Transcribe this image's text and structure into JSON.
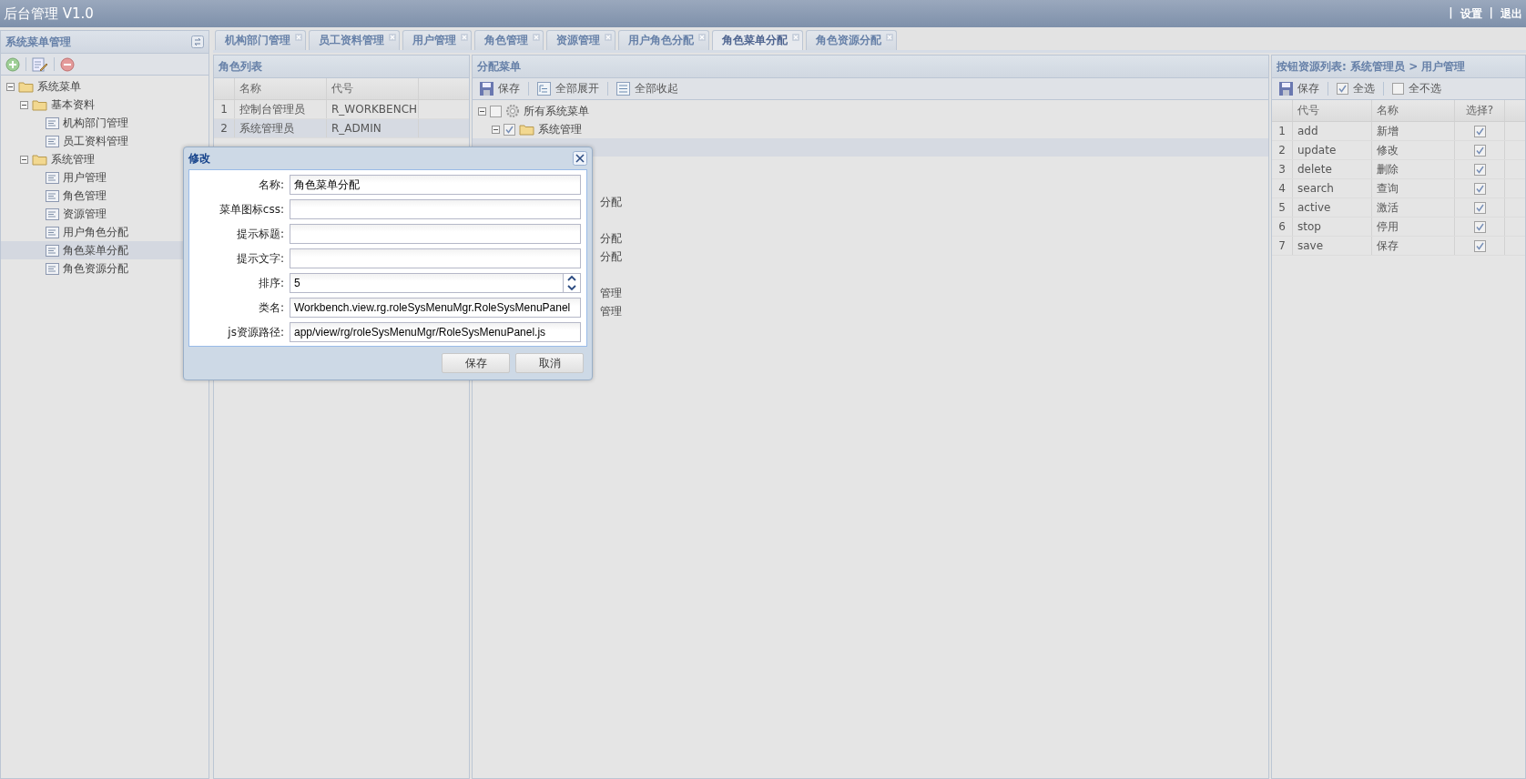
{
  "header": {
    "title": "后台管理 V1.0",
    "separator": "|",
    "links": [
      "设置",
      "退出"
    ]
  },
  "left_panel": {
    "title": "系统菜单管理",
    "tree": [
      {
        "label": "系统菜单",
        "kind": "folder",
        "expanded": true,
        "selected": false,
        "children": [
          {
            "label": "基本资料",
            "kind": "folder",
            "expanded": true,
            "selected": false,
            "children": [
              {
                "label": "机构部门管理",
                "kind": "leaf",
                "selected": false
              },
              {
                "label": "员工资料管理",
                "kind": "leaf",
                "selected": false
              }
            ]
          },
          {
            "label": "系统管理",
            "kind": "folder",
            "expanded": true,
            "selected": false,
            "children": [
              {
                "label": "用户管理",
                "kind": "leaf",
                "selected": false
              },
              {
                "label": "角色管理",
                "kind": "leaf",
                "selected": false
              },
              {
                "label": "资源管理",
                "kind": "leaf",
                "selected": false
              },
              {
                "label": "用户角色分配",
                "kind": "leaf",
                "selected": false
              },
              {
                "label": "角色菜单分配",
                "kind": "leaf",
                "selected": true
              },
              {
                "label": "角色资源分配",
                "kind": "leaf",
                "selected": false
              }
            ]
          }
        ]
      }
    ]
  },
  "tabs": [
    {
      "label": "机构部门管理",
      "selected": false
    },
    {
      "label": "员工资料管理",
      "selected": false
    },
    {
      "label": "用户管理",
      "selected": false
    },
    {
      "label": "角色管理",
      "selected": false
    },
    {
      "label": "资源管理",
      "selected": false
    },
    {
      "label": "用户角色分配",
      "selected": false
    },
    {
      "label": "角色菜单分配",
      "selected": true
    },
    {
      "label": "角色资源分配",
      "selected": false
    }
  ],
  "role_list": {
    "title": "角色列表",
    "columns": [
      "名称",
      "代号"
    ],
    "rows": [
      {
        "index": "1",
        "name": "控制台管理员",
        "code": "R_WORKBENCH",
        "selected": false
      },
      {
        "index": "2",
        "name": "系统管理员",
        "code": "R_ADMIN",
        "selected": true
      }
    ]
  },
  "menu_panel": {
    "title": "分配菜单",
    "toolbar": [
      "保存",
      "全部展开",
      "全部收起"
    ],
    "tree": [
      {
        "label": "所有系统菜单",
        "kind": "root",
        "checked": false,
        "expanded": true,
        "children": [
          {
            "label": "系统管理",
            "kind": "folder",
            "checked": true,
            "expanded": true
          }
        ]
      }
    ],
    "fragments": [
      "分配",
      "分配",
      "分配",
      "管理",
      "管理"
    ]
  },
  "resource_panel": {
    "title": "按钮资源列表: 系统管理员 > 用户管理",
    "save": "保存",
    "select_all": {
      "label": "全选",
      "checked": true
    },
    "select_none": {
      "label": "全不选",
      "checked": false
    },
    "columns": [
      "代号",
      "名称",
      "选择?"
    ],
    "rows": [
      {
        "index": "1",
        "code": "add",
        "name": "新增",
        "checked": true
      },
      {
        "index": "2",
        "code": "update",
        "name": "修改",
        "checked": true
      },
      {
        "index": "3",
        "code": "delete",
        "name": "删除",
        "checked": true
      },
      {
        "index": "4",
        "code": "search",
        "name": "查询",
        "checked": true
      },
      {
        "index": "5",
        "code": "active",
        "name": "激活",
        "checked": true
      },
      {
        "index": "6",
        "code": "stop",
        "name": "停用",
        "checked": true
      },
      {
        "index": "7",
        "code": "save",
        "name": "保存",
        "checked": true
      }
    ]
  },
  "dialog": {
    "title": "修改",
    "fields": [
      {
        "label": "名称:",
        "kind": "text",
        "value": "角色菜单分配"
      },
      {
        "label": "菜单图标css:",
        "kind": "text"
      },
      {
        "label": "提示标题:",
        "kind": "text"
      },
      {
        "label": "提示文字:",
        "kind": "text"
      },
      {
        "label": "排序:",
        "kind": "spinner",
        "value": "5"
      },
      {
        "label": "类名:",
        "kind": "text",
        "value": "Workbench.view.rg.roleSysMenuMgr.RoleSysMenuPanel"
      },
      {
        "label": "js资源路径:",
        "kind": "text",
        "value": "app/view/rg/roleSysMenuMgr/RoleSysMenuPanel.js"
      }
    ],
    "buttons": [
      "保存",
      "取消"
    ]
  }
}
